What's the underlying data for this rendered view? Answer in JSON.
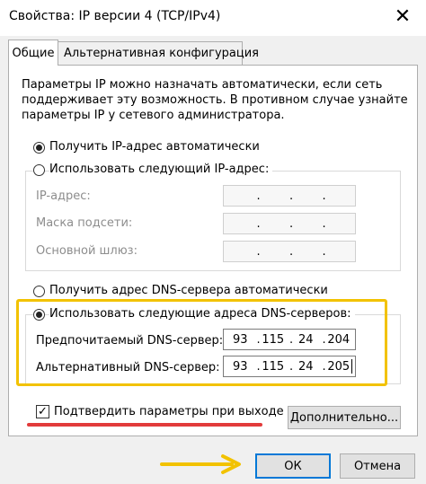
{
  "window": {
    "title": "Свойства: IP версии 4 (TCP/IPv4)",
    "close_glyph": "✕"
  },
  "tabs": [
    {
      "label": "Общие",
      "active": true
    },
    {
      "label": "Альтернативная конфигурация",
      "active": false
    }
  ],
  "description": [
    "Параметры IP можно назначать автоматически, если сеть",
    "поддерживает эту возможность. В противном случае узнайте",
    "параметры IP у сетевого администратора."
  ],
  "ip_section": {
    "auto_label": "Получить IP-адрес автоматически",
    "auto_selected": true,
    "manual_label": "Использовать следующий IP-адрес:",
    "manual_selected": false,
    "fields": [
      {
        "label": "IP-адрес:",
        "value": [
          "",
          "",
          "",
          ""
        ]
      },
      {
        "label": "Маска подсети:",
        "value": [
          "",
          "",
          "",
          ""
        ]
      },
      {
        "label": "Основной шлюз:",
        "value": [
          "",
          "",
          "",
          ""
        ]
      }
    ]
  },
  "dns_section": {
    "auto_label": "Получить адрес DNS-сервера автоматически",
    "auto_selected": false,
    "manual_label": "Использовать следующие адреса DNS-серверов:",
    "manual_selected": true,
    "preferred_label": "Предпочитаемый DNS-сервер:",
    "preferred_value": [
      "93",
      "115",
      "24",
      "204"
    ],
    "alternate_label": "Альтернативный DNS-сервер:",
    "alternate_value": [
      "93",
      "115",
      "24",
      "205"
    ]
  },
  "validate": {
    "label": "Подтвердить параметры при выходе",
    "checked": true,
    "check_glyph": "✓"
  },
  "buttons": {
    "advanced": "Дополнительно...",
    "ok": "ОК",
    "cancel": "Отмена"
  },
  "colors": {
    "highlight": "#f2c200",
    "underline": "#e23b3b",
    "arrow": "#f2c200",
    "focus": "#0078d7"
  }
}
